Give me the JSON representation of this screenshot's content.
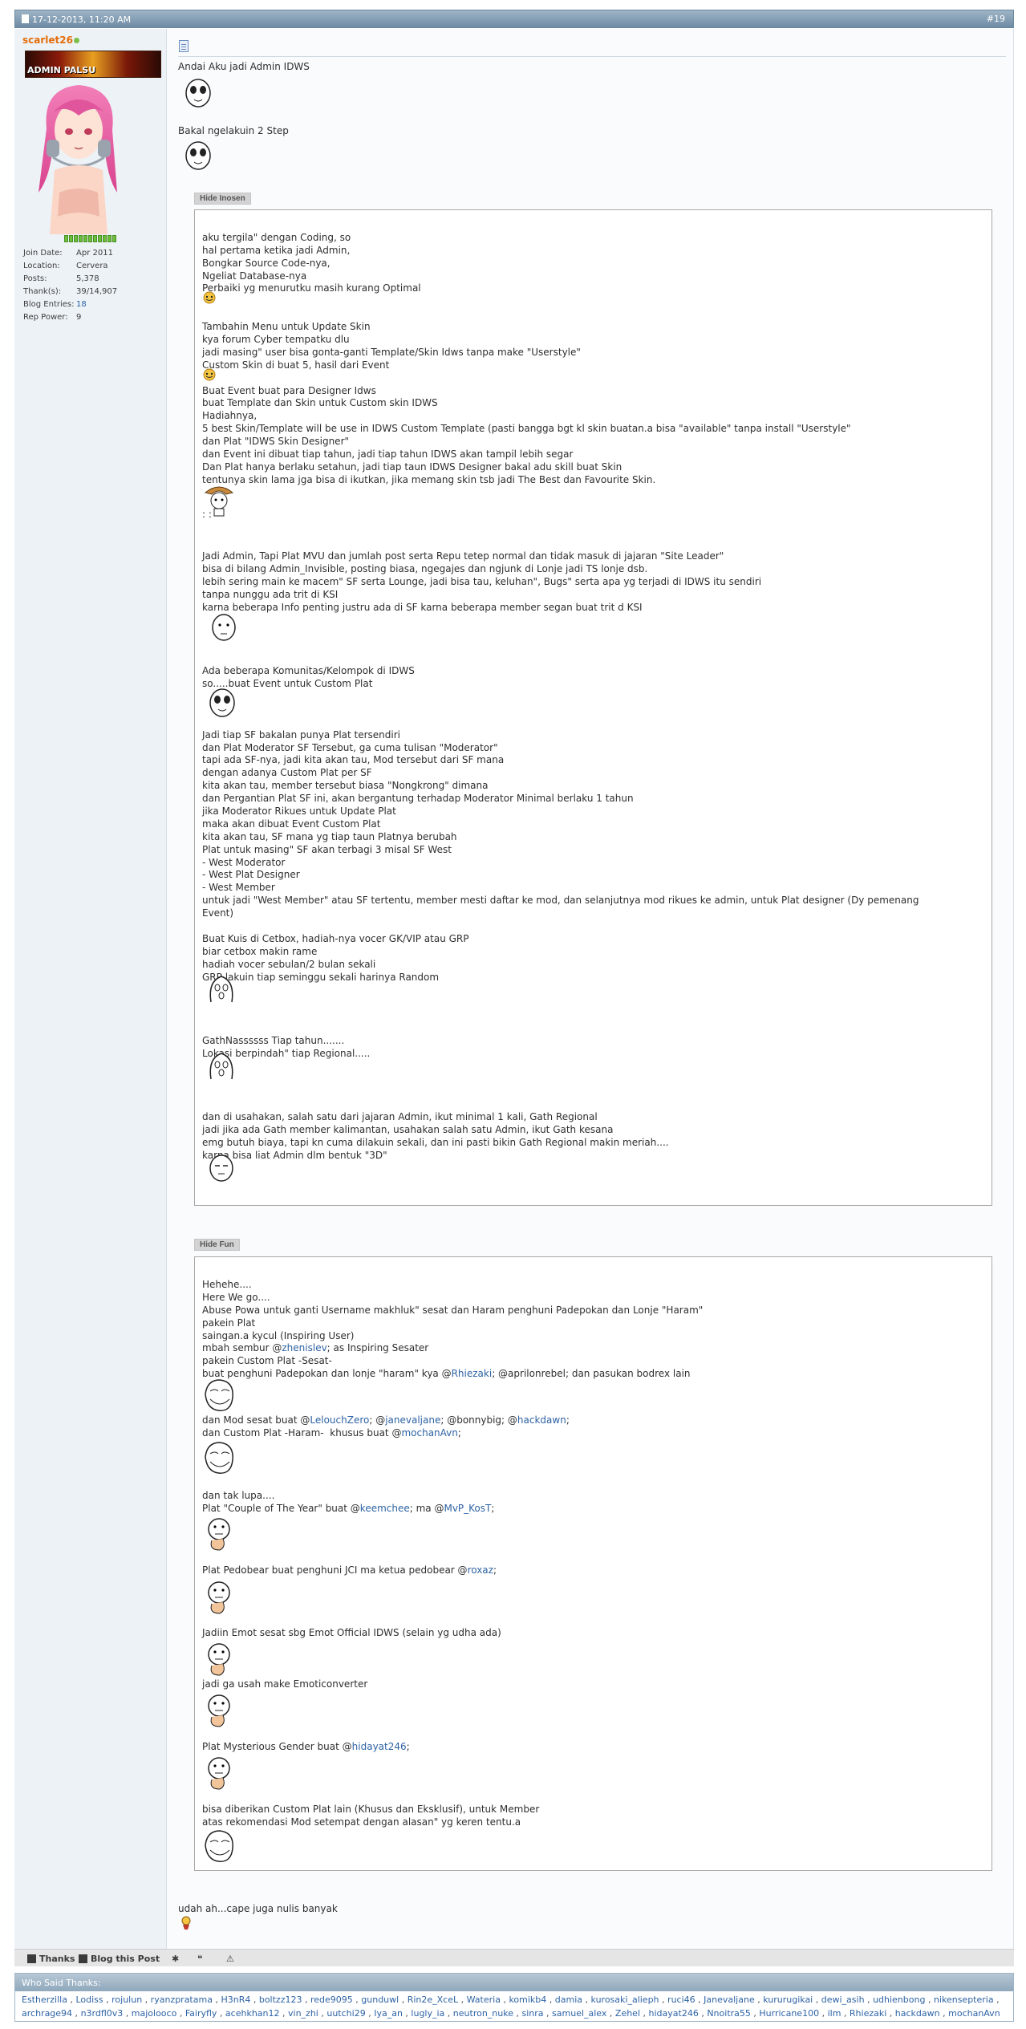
{
  "post": {
    "date": "17-12-2013, 11:20 AM",
    "number": "#19"
  },
  "user": {
    "username": "scarlet26",
    "title_image_text": "ADMIN PALSU",
    "stats": [
      {
        "label": "Join Date:",
        "value": "Apr 2011"
      },
      {
        "label": "Location:",
        "value": "Cervera"
      },
      {
        "label": "Posts:",
        "value": "5,378"
      },
      {
        "label": "Thank(s):",
        "value": "39/14,907"
      },
      {
        "label": "Blog Entries:",
        "value": "18"
      },
      {
        "label": "Rep Power:",
        "value": "9"
      }
    ]
  },
  "intro": {
    "line1": "Andai Aku jadi Admin IDWS",
    "line2": "Bakal ngelakuin 2 Step"
  },
  "spoiler1": {
    "button": "Hide Inosen",
    "lines": [
      "",
      "aku tergila\" dengan Coding, so",
      "hal pertama ketika jadi Admin,",
      "Bongkar Source Code-nya,",
      "Ngeliat Database-nya",
      "Perbaiki yg menurutku masih kurang Optimal",
      "",
      "",
      "Tambahin Menu untuk Update Skin",
      "kya forum Cyber tempatku dlu",
      "jadi masing\" user bisa gonta-ganti Template/Skin Idws tanpa make \"Userstyle\"",
      "Custom Skin di buat 5, hasil dari Event",
      "",
      "Buat Event buat para Designer Idws",
      "buat Template dan Skin untuk Custom skin IDWS",
      "Hadiahnya,",
      "5 best Skin/Template will be use in IDWS Custom Template (pasti bangga bgt kl skin buatan.a bisa \"available\" tanpa install \"Userstyle\"",
      "dan Plat \"IDWS Skin Designer\"",
      "dan Event ini dibuat tiap tahun, jadi tiap tahun IDWS akan tampil lebih segar",
      "Dan Plat hanya berlaku setahun, jadi tiap taun IDWS Designer bakal adu skill buat Skin",
      "tentunya skin lama jga bisa di ikutkan, jika memang skin tsb jadi The Best dan Favourite Skin.",
      "",
      "",
      "",
      "",
      "",
      "Jadi Admin, Tapi Plat MVU dan jumlah post serta Repu tetep normal dan tidak masuk di jajaran \"Site Leader\"",
      "bisa di bilang Admin_Invisible, posting biasa, ngegajes dan ngjunk di Lonje jadi TS lonje dsb.",
      "lebih sering main ke macem\" SF serta Lounge, jadi bisa tau, keluhan\", Bugs\" serta apa yg terjadi di IDWS itu sendiri",
      "tanpa nunggu ada trit di KSI",
      "karna beberapa Info penting justru ada di SF karna beberapa member segan buat trit d KSI",
      "",
      "",
      "",
      "",
      "Ada beberapa Komunitas/Kelompok di IDWS",
      "so.....buat Event untuk Custom Plat",
      "",
      "",
      "",
      "Jadi tiap SF bakalan punya Plat tersendiri",
      "dan Plat Moderator SF Tersebut, ga cuma tulisan \"Moderator\"",
      "tapi ada SF-nya, jadi kita akan tau, Mod tersebut dari SF mana",
      "dengan adanya Custom Plat per SF",
      "kita akan tau, member tersebut biasa \"Nongkrong\" dimana",
      "dan Pergantian Plat SF ini, akan bergantung terhadap Moderator Minimal berlaku 1 tahun",
      "jika Moderator Rikues untuk Update Plat",
      "maka akan dibuat Event Custom Plat",
      "kita akan tau, SF mana yg tiap taun Platnya berubah",
      "Plat untuk masing\" SF akan terbagi 3 misal SF West",
      "- West Moderator",
      "- West Plat Designer",
      "- West Member",
      "untuk jadi \"West Member\" atau SF tertentu, member mesti daftar ke mod, dan selanjutnya mod rikues ke admin, untuk Plat designer (Dy pemenang",
      "Event)",
      "",
      "Buat Kuis di Cetbox, hadiah-nya vocer GK/VIP atau GRP",
      "biar cetbox makin rame",
      "hadiah vocer sebulan/2 bulan sekali",
      "GRP lakuin tiap seminggu sekali harinya Random",
      "",
      "",
      "",
      "",
      "GathNassssss Tiap tahun.......",
      "Lokasi berpindah\" tiap Regional.....",
      "",
      "",
      "",
      "",
      "dan di usahakan, salah satu dari jajaran Admin, ikut minimal 1 kali, Gath Regional",
      "jadi jika ada Gath member kalimantan, usahakan salah satu Admin, ikut Gath kesana",
      "emg butuh biaya, tapi kn cuma dilakuin sekali, dan ini pasti bikin Gath Regional makin meriah....",
      "karna bisa liat Admin dlm bentuk \"3D\""
    ],
    "colon_text": ":    :"
  },
  "spoiler2": {
    "button": "Hide Fun",
    "l1": "Hehehe....",
    "l2": "Here We go....",
    "l3": "Abuse Powa untuk ganti Username makhluk\" sesat dan Haram penghuni Padepokan dan Lonje \"Haram\"",
    "l4": "pakein Plat",
    "l5": "saingan.a kycul (Inspiring User)",
    "l6a": "mbah sembur @",
    "l6b": "zhenislev",
    "l6c": "; as Inspiring Sesater",
    "l7": "pakein Custom Plat -Sesat-",
    "l8a": "buat penghuni Padepokan dan lonje \"haram\" kya @",
    "l8b": "Rhiezaki",
    "l8c": "; @aprilonrebel; dan pasukan bodrex lain",
    "m1a": "dan Mod sesat buat @",
    "m1b": "LelouchZero",
    "m1c": "; @",
    "m1d": "janevaljane",
    "m1e": "; @bonnybig; @",
    "m1f": "hackdawn",
    "m1g": ";",
    "m2a": "dan Custom Plat -Haram-  khusus buat @",
    "m2b": "mochanAvn",
    "m2c": ";",
    "n1": "dan tak lupa....",
    "n2a": "Plat \"Couple of The Year\" buat @",
    "n2b": "keemchee",
    "n2c": "; ma @",
    "n2d": "MvP_KosT",
    "n2e": ";",
    "p1a": "Plat Pedobear buat penghuni JCI ma ketua pedobear @",
    "p1b": "roxaz",
    "p1c": ";",
    "q1": "Jadiin Emot sesat sbg Emot Official IDWS (selain yg udha ada)",
    "q2": "jadi ga usah make Emoticonverter",
    "r1a": "Plat Mysterious Gender buat @",
    "r1b": "hidayat246",
    "r1c": ";",
    "s1": "bisa diberikan Custom Plat lain (Khusus dan Eksklusif), untuk Member",
    "s2": "atas rekomendasi Mod setempat dengan alasan\" yg keren tentu.a"
  },
  "closing": "udah ah...cape juga nulis banyak",
  "actions": {
    "thanks": "Thanks",
    "blog": "Blog this Post"
  },
  "thanks_panel": {
    "title": "Who Said Thanks:",
    "names": [
      "Estherzilla",
      "Lodiss",
      "rojulun",
      "ryanzpratama",
      "H3nR4",
      "boltzz123",
      "rede9095",
      "gunduwl",
      "Rin2e_XceL",
      "Wateria",
      "komikb4",
      "damia",
      "kurosaki_alieph",
      "ruci46",
      "Janevaljane",
      "kururugikai",
      "dewi_asih",
      "udhienbong",
      "nikensepteria",
      "archrage94",
      "n3rdfl0v3",
      "majolooco",
      "Fairyfly",
      "acehkhan12",
      "vin_zhi",
      "uutchi29",
      "Iya_an",
      "lugly_ia",
      "neutron_nuke",
      "sinra",
      "samuel_alex",
      "Zehel",
      "hidayat246",
      "Nnoitra55",
      "Hurricane100",
      "ilm",
      "Rhiezaki",
      "hackdawn",
      "mochanAvn"
    ]
  },
  "colors": {
    "header": "#7a97ae",
    "username": "#e46d0a",
    "link": "#2e63a4"
  }
}
